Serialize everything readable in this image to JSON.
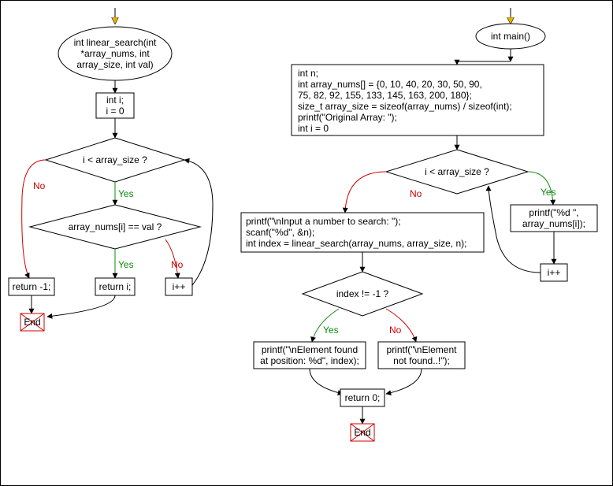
{
  "chart_data": [
    {
      "type": "flowchart",
      "start_arrow": true,
      "nodes": [
        {
          "id": "ls_decl",
          "kind": "terminator",
          "label": "int linear_search(int *array_nums, int array_size, int val)"
        },
        {
          "id": "ls_init",
          "kind": "process",
          "label": "int i;\ni = 0"
        },
        {
          "id": "ls_cond1",
          "kind": "decision",
          "label": "i < array_size ?"
        },
        {
          "id": "ls_cond2",
          "kind": "decision",
          "label": "array_nums[i] == val ?"
        },
        {
          "id": "ls_retneg",
          "kind": "process",
          "label": "return -1;"
        },
        {
          "id": "ls_reti",
          "kind": "process",
          "label": "return i;"
        },
        {
          "id": "ls_inc",
          "kind": "process",
          "label": "i++"
        },
        {
          "id": "ls_end",
          "kind": "end",
          "label": "End"
        }
      ],
      "edges": [
        {
          "from": "ls_decl",
          "to": "ls_init"
        },
        {
          "from": "ls_init",
          "to": "ls_cond1"
        },
        {
          "from": "ls_cond1",
          "to": "ls_cond2",
          "label": "Yes"
        },
        {
          "from": "ls_cond1",
          "to": "ls_retneg",
          "label": "No"
        },
        {
          "from": "ls_cond2",
          "to": "ls_reti",
          "label": "Yes"
        },
        {
          "from": "ls_cond2",
          "to": "ls_inc",
          "label": "No"
        },
        {
          "from": "ls_inc",
          "to": "ls_cond1"
        },
        {
          "from": "ls_retneg",
          "to": "ls_end"
        },
        {
          "from": "ls_reti",
          "to": "ls_end"
        }
      ]
    },
    {
      "type": "flowchart",
      "start_arrow": true,
      "nodes": [
        {
          "id": "m_decl",
          "kind": "terminator",
          "label": "int main()"
        },
        {
          "id": "m_init",
          "kind": "process",
          "label": "int n;\nint array_nums[] = {0, 10, 40, 20, 30, 50, 90, 75, 82, 92, 155, 133, 145, 163, 200, 180};\nsize_t array_size = sizeof(array_nums) / sizeof(int);\nprintf(\"Original Array: \");\nint i = 0"
        },
        {
          "id": "m_cond1",
          "kind": "decision",
          "label": "i < array_size ?"
        },
        {
          "id": "m_print",
          "kind": "process",
          "label": "printf(\"%d \", array_nums[i]);"
        },
        {
          "id": "m_inc",
          "kind": "process",
          "label": "i++"
        },
        {
          "id": "m_body",
          "kind": "process",
          "label": "printf(\"\\nInput a number to search: \");\nscanf(\"%d\", &n);\nint index = linear_search(array_nums, array_size, n);"
        },
        {
          "id": "m_cond2",
          "kind": "decision",
          "label": "index != -1 ?"
        },
        {
          "id": "m_found",
          "kind": "process",
          "label": "printf(\"\\nElement found at position: %d\", index);"
        },
        {
          "id": "m_notf",
          "kind": "process",
          "label": "printf(\"\\nElement not found..!\");"
        },
        {
          "id": "m_ret",
          "kind": "process",
          "label": "return 0;"
        },
        {
          "id": "m_end",
          "kind": "end",
          "label": "End"
        }
      ],
      "edges": [
        {
          "from": "m_decl",
          "to": "m_init"
        },
        {
          "from": "m_init",
          "to": "m_cond1"
        },
        {
          "from": "m_cond1",
          "to": "m_print",
          "label": "Yes"
        },
        {
          "from": "m_print",
          "to": "m_inc"
        },
        {
          "from": "m_inc",
          "to": "m_cond1"
        },
        {
          "from": "m_cond1",
          "to": "m_body",
          "label": "No"
        },
        {
          "from": "m_body",
          "to": "m_cond2"
        },
        {
          "from": "m_cond2",
          "to": "m_found",
          "label": "Yes"
        },
        {
          "from": "m_cond2",
          "to": "m_notf",
          "label": "No"
        },
        {
          "from": "m_found",
          "to": "m_ret"
        },
        {
          "from": "m_notf",
          "to": "m_ret"
        },
        {
          "from": "m_ret",
          "to": "m_end"
        }
      ]
    }
  ],
  "labels": {
    "yes": "Yes",
    "no": "No",
    "end": "End"
  },
  "left": {
    "decl_l1": "int linear_search(int",
    "decl_l2": "*array_nums, int",
    "decl_l3": "array_size, int val)",
    "init_l1": "int i;",
    "init_l2": "i = 0",
    "cond1": "i < array_size ?",
    "cond2": "array_nums[i] == val ?",
    "retneg": "return -1;",
    "reti": "return i;",
    "inc": "i++"
  },
  "right": {
    "decl": "int main()",
    "init_l1": "int n;",
    "init_l2": "int array_nums[] = {0, 10, 40, 20, 30, 50, 90,",
    "init_l3": "75, 82, 92, 155, 133, 145, 163, 200, 180};",
    "init_l4": "size_t array_size = sizeof(array_nums) / sizeof(int);",
    "init_l5": "printf(\"Original Array: \");",
    "init_l6": "int i = 0",
    "cond1": "i < array_size ?",
    "print_l1": "printf(\"%d \",",
    "print_l2": "array_nums[i]);",
    "inc": "i++",
    "body_l1": "printf(\"\\nInput a number to search: \");",
    "body_l2": "scanf(\"%d\", &n);",
    "body_l3": "int index = linear_search(array_nums, array_size, n);",
    "cond2": "index != -1 ?",
    "found_l1": "printf(\"\\nElement found",
    "found_l2": "at position: %d\", index);",
    "notf_l1": "printf(\"\\nElement",
    "notf_l2": "not found..!\");",
    "ret": "return 0;"
  }
}
